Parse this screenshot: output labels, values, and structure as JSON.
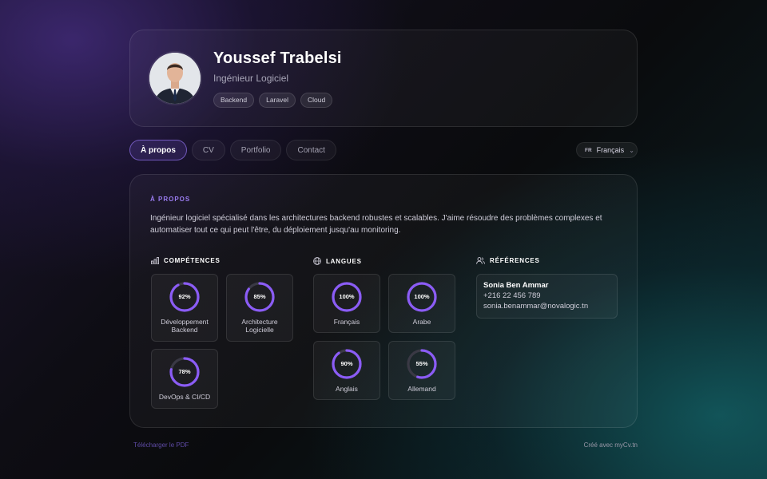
{
  "header": {
    "name": "Youssef Trabelsi",
    "role": "Ingénieur Logiciel",
    "tags": [
      "Backend",
      "Laravel",
      "Cloud"
    ]
  },
  "tabs": [
    {
      "label": "À propos",
      "active": true
    },
    {
      "label": "CV",
      "active": false
    },
    {
      "label": "Portfolio",
      "active": false
    },
    {
      "label": "Contact",
      "active": false
    }
  ],
  "language_select": {
    "code": "FR",
    "value": "Français"
  },
  "about": {
    "section_title": "À PROPOS",
    "text": "Ingénieur logiciel spécialisé dans les architectures backend robustes et scalables. J'aime résoudre des problèmes complexes et automatiser tout ce qui peut l'être, du déploiement jusqu'au monitoring."
  },
  "skills": {
    "title": "COMPÉTENCES",
    "items": [
      {
        "label": "Développement Backend",
        "value": 92,
        "display": "92%"
      },
      {
        "label": "Architecture Logicielle",
        "value": 85,
        "display": "85%"
      },
      {
        "label": "DevOps & CI/CD",
        "value": 78,
        "display": "78%"
      }
    ]
  },
  "languages": {
    "title": "LANGUES",
    "items": [
      {
        "label": "Français",
        "value": 100,
        "display": "100%"
      },
      {
        "label": "Arabe",
        "value": 100,
        "display": "100%"
      },
      {
        "label": "Anglais",
        "value": 90,
        "display": "90%"
      },
      {
        "label": "Allemand",
        "value": 55,
        "display": "55%"
      }
    ]
  },
  "references": {
    "title": "RÉFÉRENCES",
    "name": "Sonia Ben Ammar",
    "phone": "+216 22 456 789",
    "email": "sonia.benammar@novalogic.tn"
  },
  "footer": {
    "download": "Télécharger le PDF",
    "credit": "Créé avec myCv.tn"
  },
  "colors": {
    "accent": "#8b5cf6",
    "ring_track": "#3a3945"
  }
}
